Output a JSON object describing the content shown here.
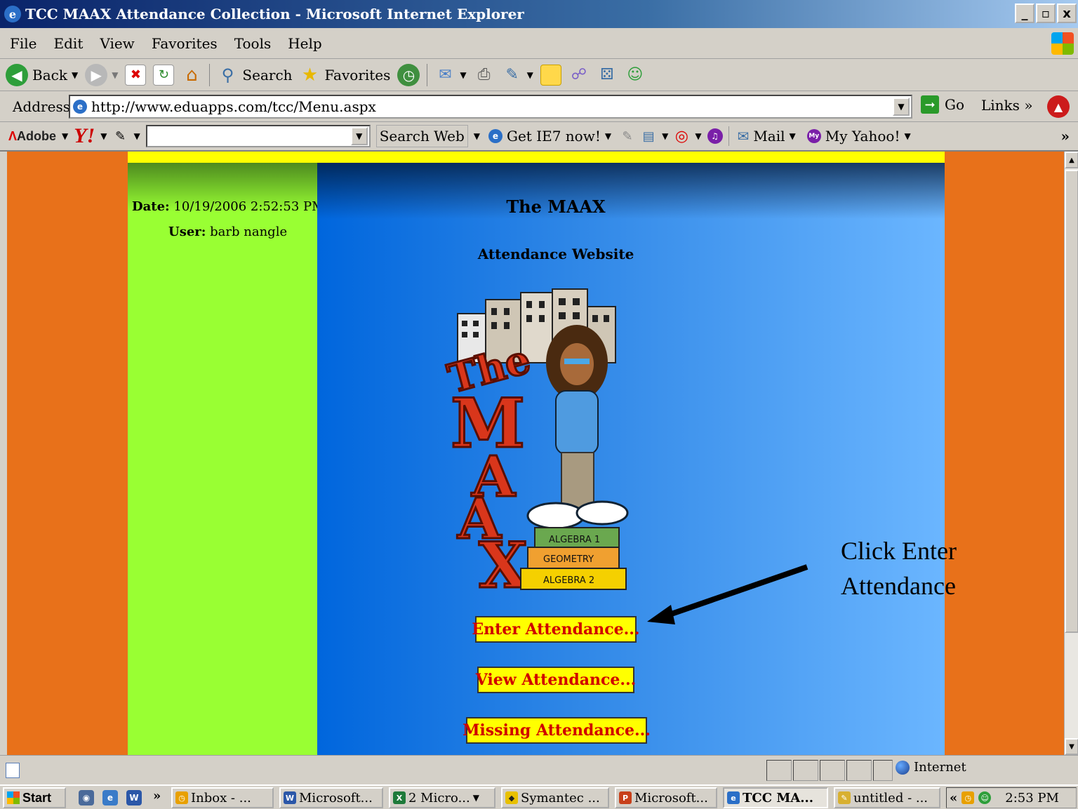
{
  "window": {
    "title": "TCC MAAX Attendance Collection - Microsoft Internet Explorer",
    "controls": [
      "_",
      "▫",
      "x"
    ]
  },
  "menubar": {
    "items": [
      "File",
      "Edit",
      "View",
      "Favorites",
      "Tools",
      "Help"
    ]
  },
  "toolbar": {
    "back": "Back",
    "search": "Search",
    "favorites": "Favorites"
  },
  "addressbar": {
    "label": "Address",
    "url": "http://www.eduapps.com/tcc/Menu.aspx",
    "go": "Go",
    "links": "Links",
    "links_chevron": "»"
  },
  "yahoobar": {
    "adobe": "Adobe",
    "yahoo": "Y!",
    "search_value": "",
    "search_web": "Search Web",
    "get_ie7": "Get IE7 now!",
    "mail": "Mail",
    "my_yahoo": "My Yahoo!",
    "more": "»"
  },
  "page": {
    "date_label": "Date:",
    "date_value": "10/19/2006 2:52:53 PM",
    "user_label": "User:",
    "user_value": "barb nangle",
    "title": "The MAAX",
    "subtitle": "Attendance Website",
    "logo_books": [
      "ALGEBRA 1",
      "GEOMETRY",
      "ALGEBRA 2"
    ],
    "buttons": {
      "enter": "Enter Attendance...",
      "view": "View Attendance...",
      "missing": "Missing Attendance..."
    },
    "callout_line1": "Click Enter",
    "callout_line2": "Attendance"
  },
  "statusbar": {
    "zone": "Internet"
  },
  "taskbar": {
    "start": "Start",
    "chevron": "»",
    "tasks": [
      {
        "label": "Inbox - ...",
        "icon": "outlook-icon"
      },
      {
        "label": "Microsoft...",
        "icon": "word-icon"
      },
      {
        "label": "2 Micro...",
        "icon": "excel-icon"
      },
      {
        "label": "Symantec ...",
        "icon": "symantec-icon"
      },
      {
        "label": "Microsoft...",
        "icon": "powerpoint-icon"
      },
      {
        "label": "TCC MA...",
        "icon": "ie-icon",
        "active": true
      },
      {
        "label": "untitled - ...",
        "icon": "paint-icon"
      }
    ],
    "tray_chevron": "«",
    "clock": "2:53 PM"
  },
  "colors": {
    "page_background": "#e8711a",
    "left_panel": "#99ff33",
    "main_panel_start": "#0066dd",
    "main_panel_end": "#6bb6ff",
    "button_background": "#ffff00",
    "button_text": "#d00000",
    "top_strip": "#ffff00"
  }
}
